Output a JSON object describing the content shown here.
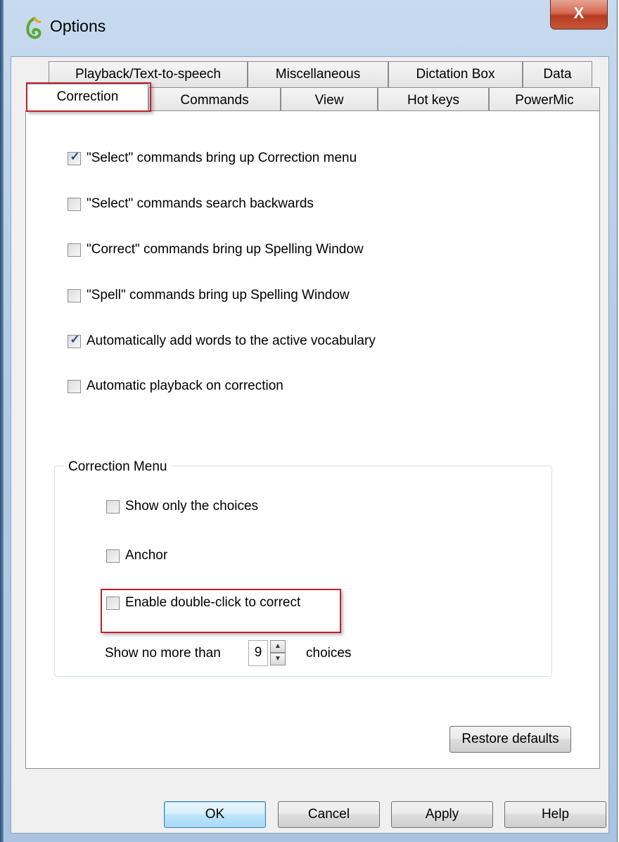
{
  "window": {
    "title": "Options",
    "close_symbol": "X",
    "icon": "dragon-app-icon"
  },
  "tabs": {
    "row_back": [
      "Playback/Text-to-speech",
      "Miscellaneous",
      "Dictation Box",
      "Data"
    ],
    "row_front": [
      "Correction",
      "Commands",
      "View",
      "Hot keys",
      "PowerMic"
    ],
    "active": "Correction"
  },
  "options": [
    {
      "label": "\"Select\" commands bring up Correction menu",
      "checked": true
    },
    {
      "label": "\"Select\" commands search backwards",
      "checked": false
    },
    {
      "label": "\"Correct\" commands bring up Spelling Window",
      "checked": false
    },
    {
      "label": "\"Spell\" commands bring up Spelling Window",
      "checked": false
    },
    {
      "label": "Automatically add words to the active vocabulary",
      "checked": true
    },
    {
      "label": "Automatic playback on correction",
      "checked": false
    }
  ],
  "correction_menu": {
    "title": "Correction Menu",
    "items": [
      {
        "label": "Show only the choices",
        "checked": false
      },
      {
        "label": "Anchor",
        "checked": false
      },
      {
        "label": "Enable double-click to correct",
        "checked": false
      }
    ],
    "show_prefix": "Show no more than",
    "choices_value": "9",
    "show_suffix": "choices"
  },
  "buttons": {
    "restore": "Restore defaults",
    "ok": "OK",
    "cancel": "Cancel",
    "apply": "Apply",
    "help": "Help"
  },
  "colors": {
    "highlight": "#c0202a",
    "check": "#1d4f91"
  }
}
